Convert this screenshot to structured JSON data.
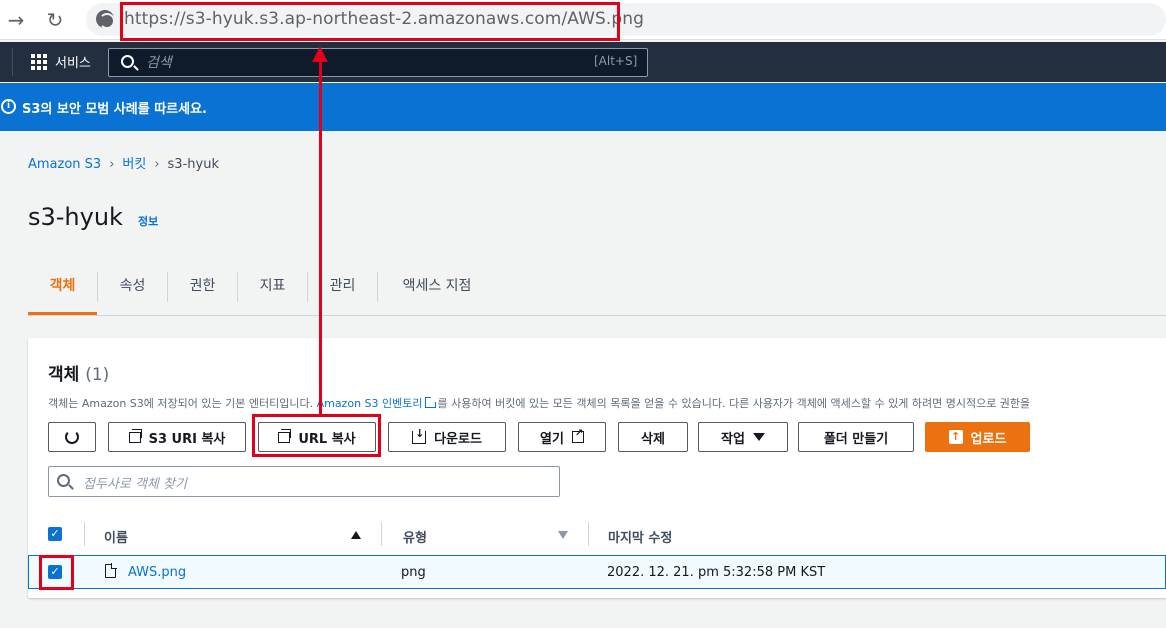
{
  "browser": {
    "back_icon": "arrow-right-icon",
    "url": "https://s3-hyuk.s3.ap-northeast-2.amazonaws.com/AWS.png"
  },
  "nav": {
    "services_label": "서비스",
    "search_placeholder": "검색",
    "search_shortcut": "[Alt+S]"
  },
  "flash": {
    "message": "S3의 보안 모범 사례를 따르세요."
  },
  "breadcrumb": {
    "items": [
      "Amazon S3",
      "버킷",
      "s3-hyuk"
    ],
    "separator": "›"
  },
  "page": {
    "title": "s3-hyuk",
    "info_link": "정보"
  },
  "tabs": [
    {
      "label": "객체",
      "active": true
    },
    {
      "label": "속성"
    },
    {
      "label": "권한"
    },
    {
      "label": "지표"
    },
    {
      "label": "관리"
    },
    {
      "label": "액세스 지점"
    }
  ],
  "objects_panel": {
    "title": "객체",
    "count": "(1)",
    "description_before": "객체는 Amazon S3에 저장되어 있는 기본 엔터티입니다. ",
    "description_link": "Amazon S3 인벤토리",
    "description_after": "를 사용하여 버킷에 있는 모든 객체의 목록을 얻을 수 있습니다. 다른 사용자가 객체에 액세스할 수 있게 하려면 명시적으로 권한을"
  },
  "toolbar": {
    "copy_s3_uri": "S3 URI 복사",
    "copy_url": "URL 복사",
    "download": "다운로드",
    "open": "열기",
    "delete": "삭제",
    "actions": "작업",
    "create_folder": "폴더 만들기",
    "upload": "업로드"
  },
  "filter": {
    "placeholder": "접두사로 객체 찾기"
  },
  "table": {
    "headers": [
      "이름",
      "유형",
      "마지막 수정"
    ],
    "rows": [
      {
        "name": "AWS.png",
        "type": "png",
        "modified": "2022. 12. 21. pm 5:32:58 PM KST",
        "selected": true
      }
    ]
  },
  "colors": {
    "accent": "#ec7211",
    "link": "#0972d3",
    "annotation": "#e2001a",
    "nav_bg": "#232f3e"
  }
}
